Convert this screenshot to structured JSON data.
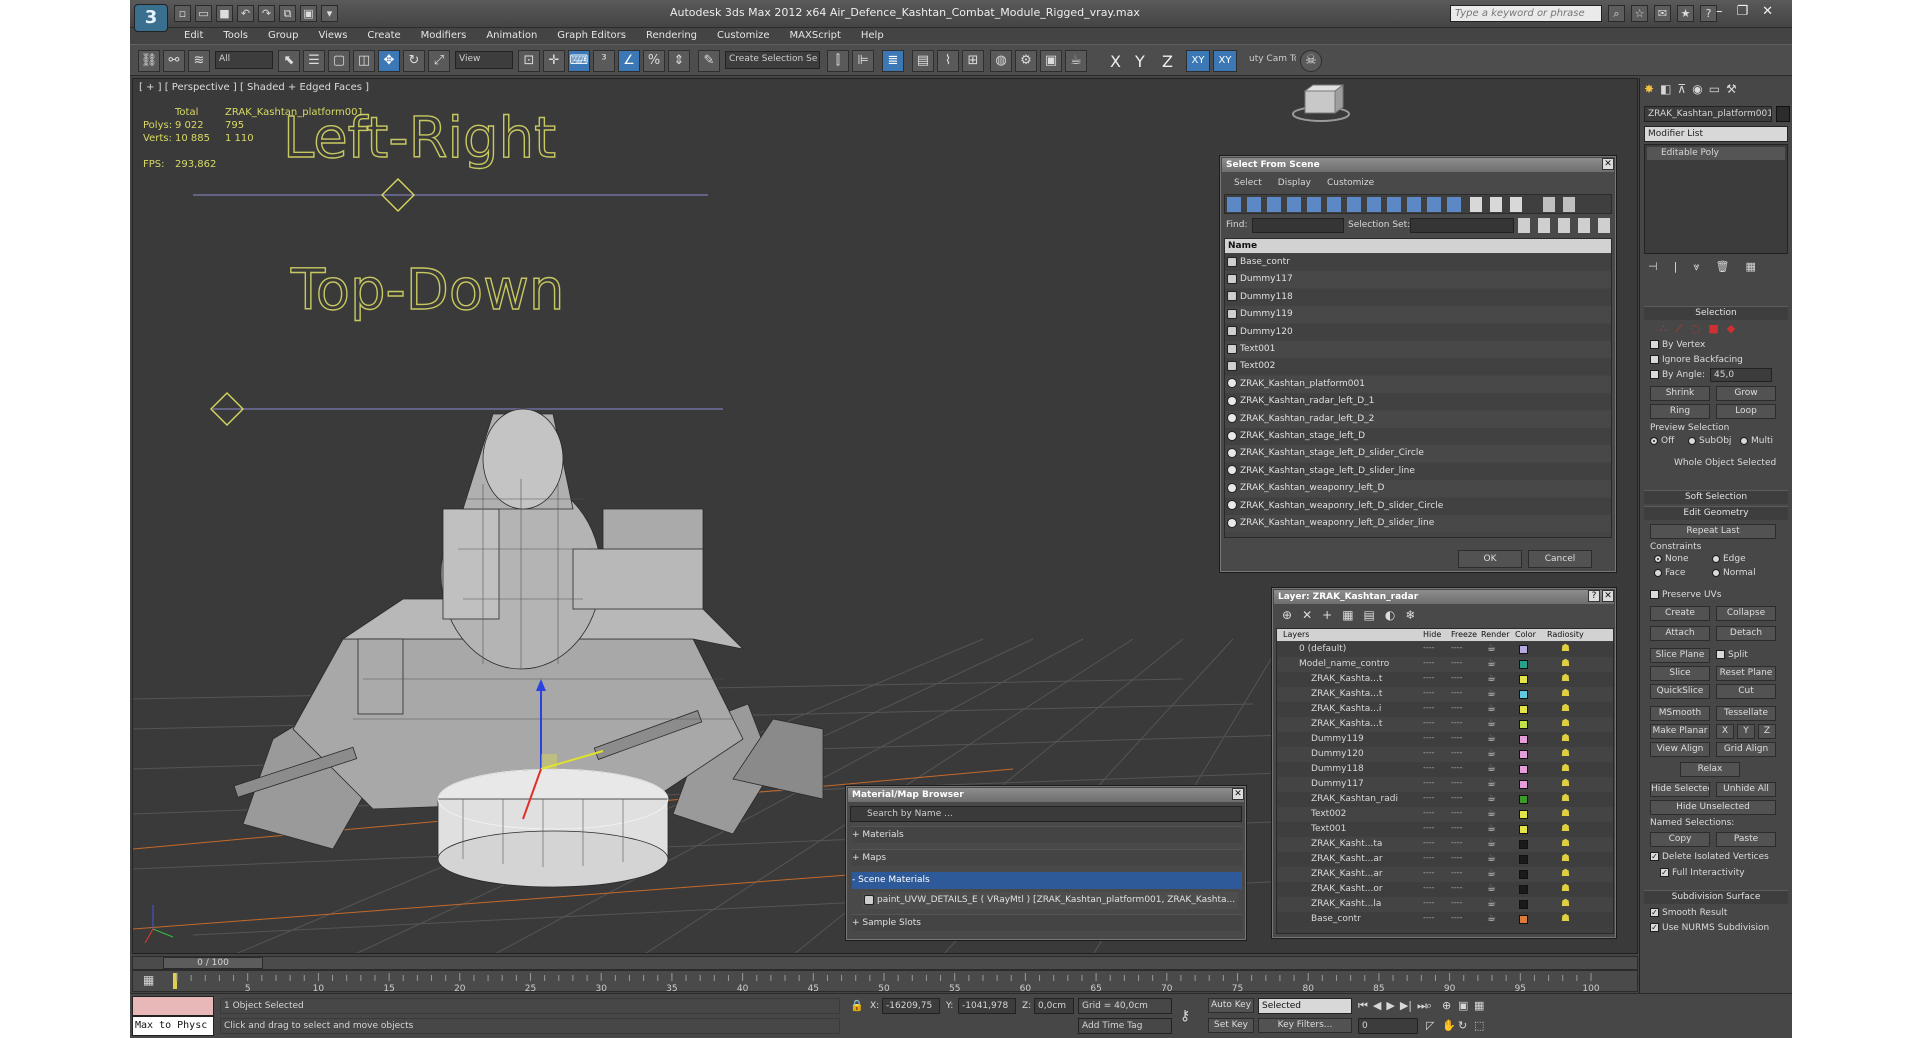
{
  "app": {
    "title": "Autodesk 3ds Max  2012 x64      Air_Defence_Kashtan_Combat_Module_Rigged_vray.max",
    "search_placeholder": "Type a keyword or phrase",
    "logo": "3"
  },
  "menu": [
    "Edit",
    "Tools",
    "Group",
    "Views",
    "Create",
    "Modifiers",
    "Animation",
    "Graph Editors",
    "Rendering",
    "Customize",
    "MAXScript",
    "Help"
  ],
  "toolbar": {
    "filter": "All",
    "ref_coord": "View",
    "selection_set": "Create Selection Se",
    "axis_labels": [
      "X",
      "Y",
      "Z",
      "XY",
      "XY"
    ],
    "cam_tool": "uty Cam Tool \\"
  },
  "viewport": {
    "label": "[ + ] [ Perspective ] [ Shaded + Edged Faces ]",
    "stats": {
      "col1": "Total",
      "col2": "ZRAK_Kashtan_platform001",
      "polys_label": "Polys:",
      "polys_total": "9 022",
      "polys_sel": "795",
      "verts_label": "Verts:",
      "verts_total": "10 885",
      "verts_sel": "1 110",
      "fps_label": "FPS:",
      "fps": "293,862"
    },
    "text_left_right": "Left-Right",
    "text_top_down": "Top-Down"
  },
  "select_from_scene": {
    "title": "Select From Scene",
    "tabs": [
      "Select",
      "Display",
      "Customize"
    ],
    "find_label": "Find:",
    "selection_set_label": "Selection Set:",
    "column": "Name",
    "items": [
      "Base_contr",
      "Dummy117",
      "Dummy118",
      "Dummy119",
      "Dummy120",
      "Text001",
      "Text002",
      "ZRAK_Kashtan_platform001",
      "ZRAK_Kashtan_radar_left_D_1",
      "ZRAK_Kashtan_radar_left_D_2",
      "ZRAK_Kashtan_stage_left_D",
      "ZRAK_Kashtan_stage_left_D_slider_Circle",
      "ZRAK_Kashtan_stage_left_D_slider_line",
      "ZRAK_Kashtan_weaponry_left_D",
      "ZRAK_Kashtan_weaponry_left_D_slider_Circle",
      "ZRAK_Kashtan_weaponry_left_D_slider_line"
    ],
    "ok": "OK",
    "cancel": "Cancel"
  },
  "layer_dialog": {
    "title": "Layer: ZRAK_Kashtan_radar",
    "columns": [
      "Layers",
      "Hide",
      "Freeze",
      "Render",
      "Color",
      "Radiosity"
    ],
    "rows": [
      {
        "name": "0 (default)",
        "color": "#b5a9e0"
      },
      {
        "name": "Model_name_contro",
        "color": "#2aa08c"
      },
      {
        "name": "ZRAK_Kashta...t",
        "color": "#e3e34a"
      },
      {
        "name": "ZRAK_Kashta...t",
        "color": "#60c8e0"
      },
      {
        "name": "ZRAK_Kashta...i",
        "color": "#e3e34a"
      },
      {
        "name": "ZRAK_Kashta...t",
        "color": "#c2e24a"
      },
      {
        "name": "Dummy119",
        "color": "#e59ed9"
      },
      {
        "name": "Dummy120",
        "color": "#e59ed9"
      },
      {
        "name": "Dummy118",
        "color": "#e59ed9"
      },
      {
        "name": "Dummy117",
        "color": "#e59ed9"
      },
      {
        "name": "ZRAK_Kashtan_radi",
        "color": "#3b9a2a"
      },
      {
        "name": "Text002",
        "color": "#e3e34a"
      },
      {
        "name": "Text001",
        "color": "#e3e34a"
      },
      {
        "name": "ZRAK_Kasht...ta",
        "color": "#1a1a1a"
      },
      {
        "name": "ZRAK_Kasht...ar",
        "color": "#1a1a1a"
      },
      {
        "name": "ZRAK_Kasht...ar",
        "color": "#1a1a1a"
      },
      {
        "name": "ZRAK_Kasht...or",
        "color": "#1a1a1a"
      },
      {
        "name": "ZRAK_Kasht...la",
        "color": "#1a1a1a"
      },
      {
        "name": "Base_contr",
        "color": "#e07a3a"
      }
    ],
    "dash": "----"
  },
  "material_browser": {
    "title": "Material/Map Browser",
    "search": "Search by Name ...",
    "sections": [
      "+ Materials",
      "+ Maps",
      "- Scene Materials",
      "+ Sample Slots"
    ],
    "scene_item": "paint_UVW_DETAILS_E  ( VRayMtl )  [ZRAK_Kashtan_platform001, ZRAK_Kashta..."
  },
  "command_panel": {
    "object_name": "ZRAK_Kashtan_platform001",
    "modifier_list": "Modifier List",
    "stack_item": "Editable Poly",
    "selection_head": "Selection",
    "by_vertex": "By Vertex",
    "ignore_backfacing": "Ignore Backfacing",
    "by_angle": "By Angle:",
    "angle_value": "45,0",
    "shrink": "Shrink",
    "grow": "Grow",
    "ring": "Ring",
    "loop": "Loop",
    "preview_selection": "Preview Selection",
    "off": "Off",
    "subobj": "SubObj",
    "multi": "Multi",
    "whole_object": "Whole Object Selected",
    "soft_selection": "Soft Selection",
    "edit_geometry": "Edit Geometry",
    "repeat_last": "Repeat Last",
    "constraints": "Constraints",
    "none": "None",
    "edge": "Edge",
    "face": "Face",
    "normal": "Normal",
    "preserve_uvs": "Preserve UVs",
    "create": "Create",
    "collapse": "Collapse",
    "attach": "Attach",
    "detach": "Detach",
    "slice_plane": "Slice Plane",
    "split": "Split",
    "slice": "Slice",
    "reset_plane": "Reset Plane",
    "quickslice": "QuickSlice",
    "cut": "Cut",
    "msmooth": "MSmooth",
    "tessellate": "Tessellate",
    "make_planar": "Make Planar",
    "x": "X",
    "y": "Y",
    "z": "Z",
    "view_align": "View Align",
    "grid_align": "Grid Align",
    "relax": "Relax",
    "hide_selected": "Hide Selected",
    "unhide_all": "Unhide All",
    "hide_unselected": "Hide Unselected",
    "named_selections": "Named Selections:",
    "copy": "Copy",
    "paste": "Paste",
    "delete_isolated": "Delete Isolated Vertices",
    "full_interactivity": "Full Interactivity",
    "subdivision_surface": "Subdivision Surface",
    "smooth_result": "Smooth Result",
    "nurms": "Use NURMS Subdivision"
  },
  "timeline": {
    "frame": "0 / 100",
    "ticks": [
      "5",
      "10",
      "15",
      "20",
      "25",
      "30",
      "35",
      "40",
      "45",
      "50",
      "55",
      "60",
      "65",
      "70",
      "75",
      "80",
      "85",
      "90",
      "95",
      "100"
    ]
  },
  "status": {
    "maxscript": "Max to Physc",
    "selected": "1 Object Selected",
    "prompt": "Click and drag to select and move objects",
    "x_label": "X:",
    "x": "-16209,75",
    "y_label": "Y:",
    "y": "-1041,978",
    "z_label": "Z:",
    "z": "0,0cm",
    "grid": "Grid = 40,0cm",
    "add_time_tag": "Add Time Tag",
    "auto_key": "Auto Key",
    "selected_dropdown": "Selected",
    "set_key": "Set Key",
    "key_filters": "Key Filters...",
    "frame": "0"
  }
}
